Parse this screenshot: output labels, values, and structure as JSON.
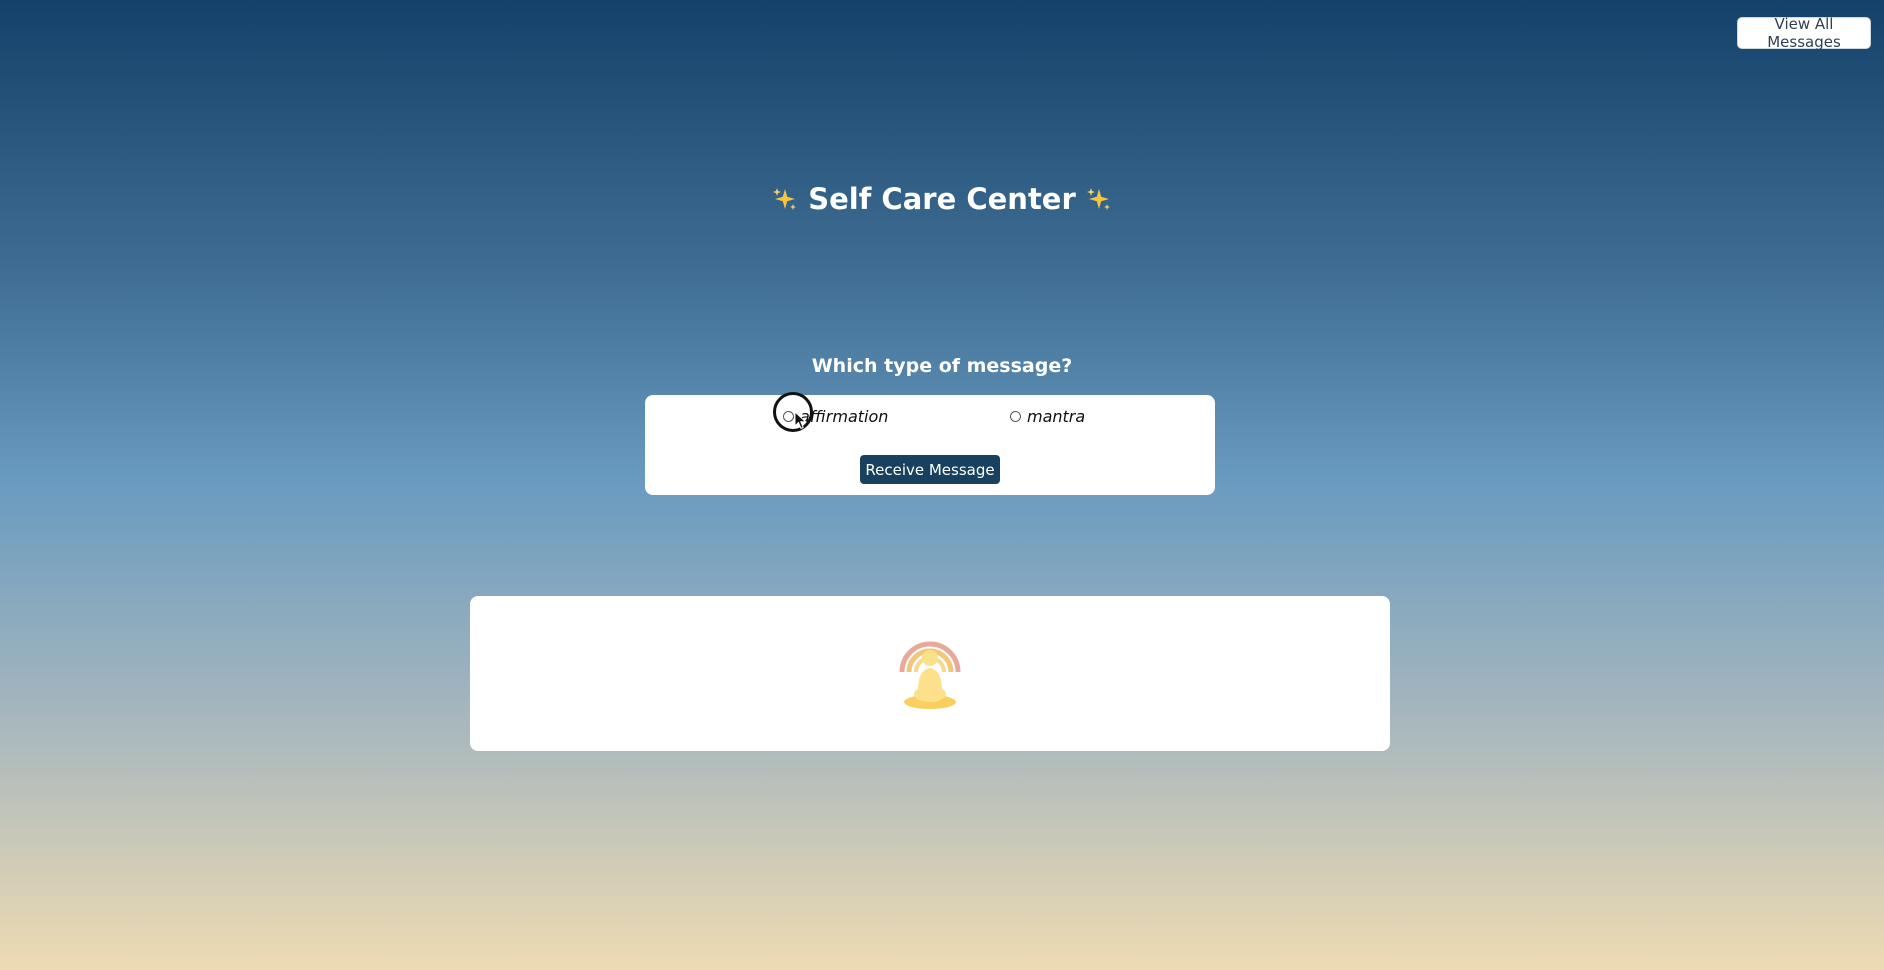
{
  "header": {
    "view_all_label": "View All Messages"
  },
  "title": {
    "text": "Self Care Center",
    "left_icon": "sparkles-icon",
    "right_icon": "sparkles-icon"
  },
  "form": {
    "question": "Which type of message?",
    "options": [
      {
        "label": "affirmation",
        "selected": false
      },
      {
        "label": "mantra",
        "selected": false
      }
    ],
    "submit_label": "Receive Message"
  },
  "message_area": {
    "icon": "meditation-icon"
  },
  "colors": {
    "button_bg": "#17415f",
    "sparkle": "#f5c542",
    "icon_body": "#fde08a",
    "icon_rings": "#e8a89a"
  }
}
